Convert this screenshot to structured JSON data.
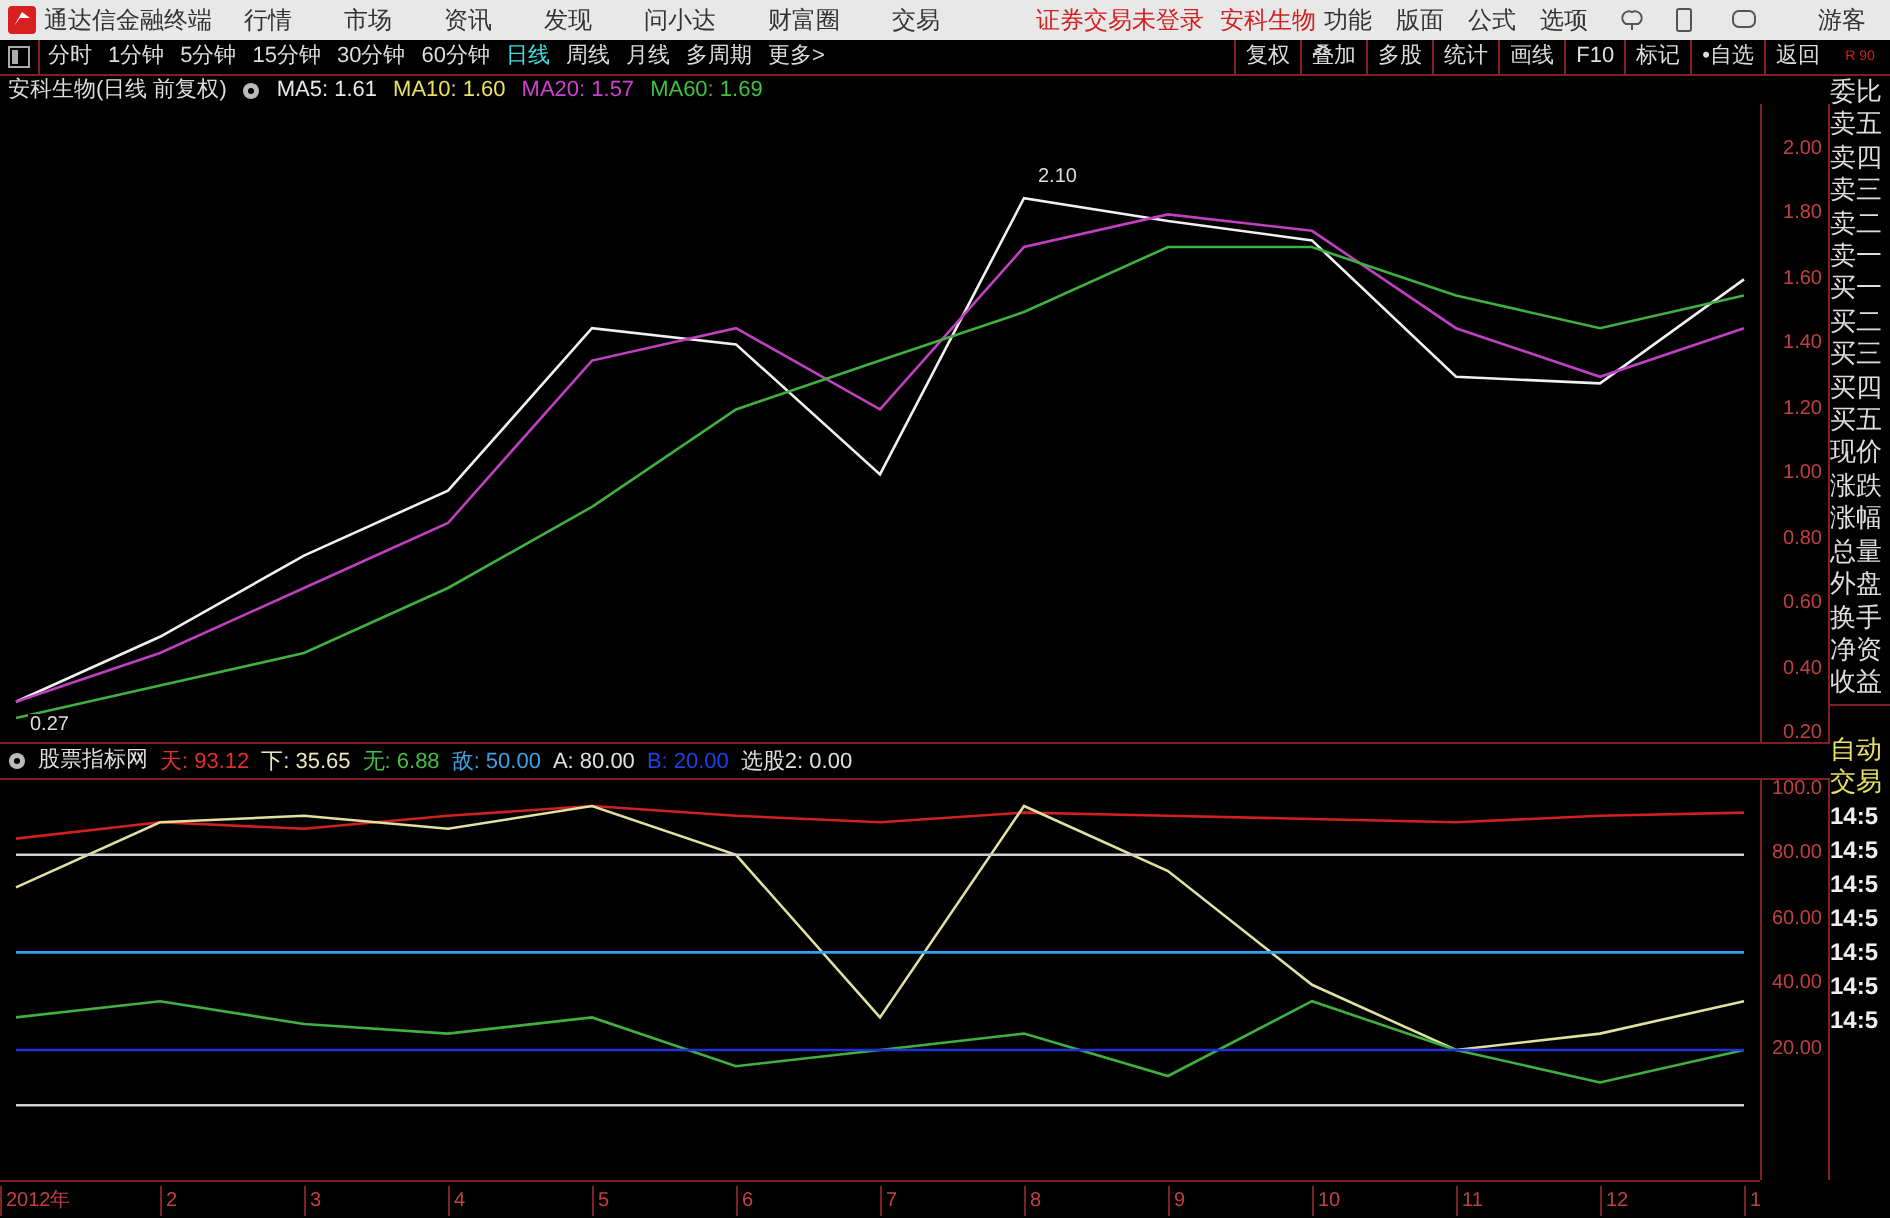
{
  "title_bar": {
    "app_name": "通达信金融终端",
    "menu": [
      "行情",
      "市场",
      "资讯",
      "发现",
      "问小达",
      "财富圈",
      "交易"
    ],
    "notices": [
      "证券交易未登录",
      "安科生物"
    ],
    "right_menu": [
      "功能",
      "版面",
      "公式",
      "选项"
    ],
    "user": "游客"
  },
  "period_tabs": [
    {
      "label": "分时",
      "selected": false
    },
    {
      "label": "1分钟",
      "selected": false
    },
    {
      "label": "5分钟",
      "selected": false
    },
    {
      "label": "15分钟",
      "selected": false
    },
    {
      "label": "30分钟",
      "selected": false
    },
    {
      "label": "60分钟",
      "selected": false
    },
    {
      "label": "日线",
      "selected": true
    },
    {
      "label": "周线",
      "selected": false
    },
    {
      "label": "月线",
      "selected": false
    },
    {
      "label": "多周期",
      "selected": false
    },
    {
      "label": "更多>",
      "selected": false
    }
  ],
  "tool_buttons": [
    "复权",
    "叠加",
    "多股",
    "统计",
    "画线",
    "F10",
    "标记",
    "•自选",
    "返回"
  ],
  "corner_label": "R 90",
  "main_chart": {
    "title": "安科生物(日线 前复权)",
    "legend": [
      {
        "text": "MA5: 1.61",
        "color": "#e8e8e8"
      },
      {
        "text": "MA10: 1.60",
        "color": "#e8e060"
      },
      {
        "text": "MA20: 1.57",
        "color": "#d040d0"
      },
      {
        "text": "MA60: 1.69",
        "color": "#40c040"
      }
    ],
    "chart_data": {
      "type": "line",
      "ylim": [
        0.17,
        2.14
      ],
      "yticks": [
        {
          "value": 2.0,
          "label": "2.00"
        },
        {
          "value": 1.8,
          "label": "1.80"
        },
        {
          "value": 1.6,
          "label": "1.60"
        },
        {
          "value": 1.4,
          "label": "1.40"
        },
        {
          "value": 1.2,
          "label": "1.20"
        },
        {
          "value": 1.0,
          "label": "1.00"
        },
        {
          "value": 0.8,
          "label": "0.80"
        },
        {
          "value": 0.6,
          "label": "0.60"
        },
        {
          "value": 0.4,
          "label": "0.40"
        },
        {
          "value": 0.2,
          "label": "0.20"
        }
      ],
      "series": [
        {
          "color": "#f0f0f0",
          "values": [
            0.3,
            0.5,
            0.75,
            0.95,
            1.45,
            1.4,
            1.0,
            1.85,
            1.78,
            1.72,
            1.3,
            1.28,
            1.6
          ]
        },
        {
          "color": "#c040c0",
          "values": [
            0.3,
            0.45,
            0.65,
            0.85,
            1.35,
            1.45,
            1.2,
            1.7,
            1.8,
            1.75,
            1.45,
            1.3,
            1.45
          ]
        },
        {
          "color": "#40b040",
          "values": [
            0.25,
            0.35,
            0.45,
            0.65,
            0.9,
            1.2,
            1.35,
            1.5,
            1.7,
            1.7,
            1.55,
            1.45,
            1.55
          ]
        }
      ],
      "annotations": [
        "2.10",
        "0.27"
      ]
    }
  },
  "indicator": {
    "title": "股票指标网",
    "values": [
      {
        "text": "天: 93.12",
        "color": "#e03030"
      },
      {
        "text": "下: 35.65",
        "color": "#e8e8c0"
      },
      {
        "text": "无: 6.88",
        "color": "#40c040"
      },
      {
        "text": "敌: 50.00",
        "color": "#40a0e0"
      },
      {
        "text": "A: 80.00",
        "color": "#e0e0e0"
      },
      {
        "text": "B: 20.00",
        "color": "#2040e0"
      },
      {
        "text": "选股2: 0.00",
        "color": "#e0e0e0"
      }
    ],
    "chart_data": {
      "type": "line",
      "categories": [
        "2012年",
        "2",
        "3",
        "4",
        "5",
        "6",
        "7",
        "8",
        "9",
        "10",
        "11",
        "12",
        "1"
      ],
      "ylim": [
        -20,
        103
      ],
      "yticks": [
        {
          "value": 100,
          "label": "100.0"
        },
        {
          "value": 80,
          "label": "80.00"
        },
        {
          "value": 60,
          "label": "60.00"
        },
        {
          "value": 40,
          "label": "40.00"
        },
        {
          "value": 20,
          "label": "20.00"
        }
      ],
      "series": [
        {
          "color": "#d02020",
          "values": [
            85,
            90,
            88,
            92,
            95,
            92,
            90,
            93,
            92,
            91,
            90,
            92,
            93
          ]
        },
        {
          "color": "#e0e0a0",
          "values": [
            70,
            90,
            92,
            88,
            95,
            80,
            30,
            95,
            75,
            40,
            20,
            25,
            35
          ]
        },
        {
          "color": "#40b040",
          "values": [
            30,
            35,
            28,
            25,
            30,
            15,
            20,
            25,
            12,
            35,
            20,
            10,
            20
          ]
        },
        {
          "color": "#d0d0d0",
          "values": [
            80,
            80,
            80,
            80,
            80,
            80,
            80,
            80,
            80,
            80,
            80,
            80,
            80
          ]
        },
        {
          "color": "#30a0f0",
          "values": [
            50,
            50,
            50,
            50,
            50,
            50,
            50,
            50,
            50,
            50,
            50,
            50,
            50
          ]
        },
        {
          "color": "#2030e0",
          "values": [
            20,
            20,
            20,
            20,
            20,
            20,
            20,
            20,
            20,
            20,
            20,
            20,
            20
          ]
        },
        {
          "color": "#d0d0d0",
          "values": [
            3,
            3,
            3,
            3,
            3,
            3,
            3,
            3,
            3,
            3,
            3,
            3,
            3
          ]
        }
      ]
    }
  },
  "quote_labels": [
    "委比",
    "卖五",
    "卖四",
    "卖三",
    "卖二",
    "卖一",
    "买一",
    "买二",
    "买三",
    "买四",
    "买五",
    "现价",
    "涨跌",
    "涨幅",
    "总量",
    "外盘",
    "换手",
    "净资",
    "收益"
  ],
  "trade_labels": [
    "自动",
    "交易"
  ],
  "trade_times": [
    "14:5",
    "14:5",
    "14:5",
    "14:5",
    "14:5",
    "14:5",
    "14:5"
  ]
}
